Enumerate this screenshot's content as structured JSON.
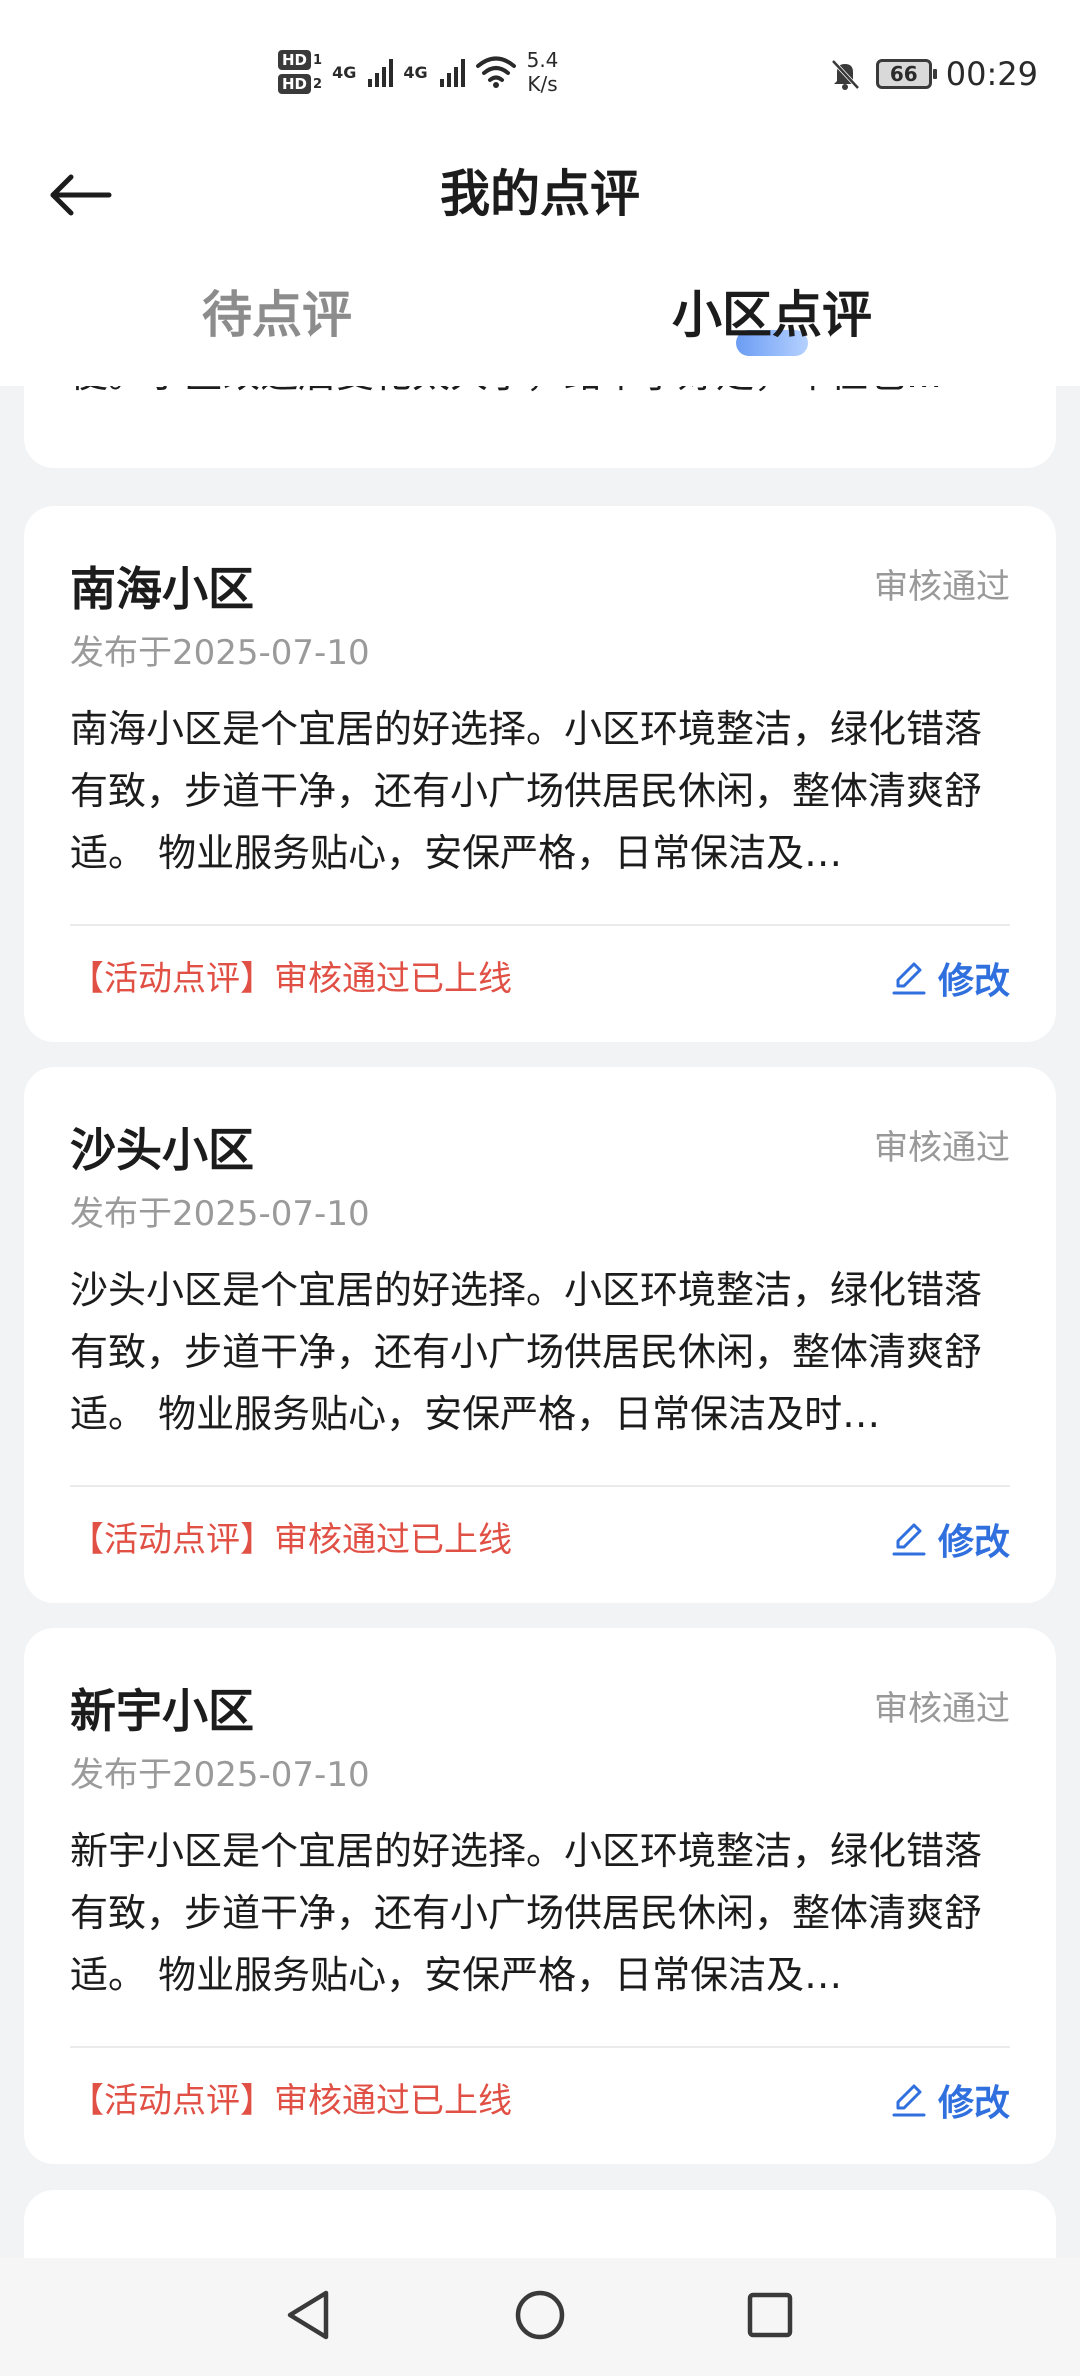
{
  "status_bar": {
    "sim1": "HD",
    "sim1_index": "1",
    "sim2": "HD",
    "sim2_index": "2",
    "network1": "4G",
    "network2": "4G",
    "speed_value": "5.4",
    "speed_unit": "K/s",
    "battery": "66",
    "time": "00:29"
  },
  "header": {
    "title": "我的点评"
  },
  "tabs": {
    "pending": "待点评",
    "community": "小区点评",
    "active": "community",
    "accent_color": "#3a7cf0"
  },
  "partial_card": {
    "text": "便。小区改造后变化太大了，路平了好走，车位也..."
  },
  "reviews": [
    {
      "name": "南海小区",
      "status": "审核通过",
      "date": "发布于2025-07-10",
      "body": "南海小区是个宜居的好选择。小区环境整洁，绿化错落有致，步道干净，还有小广场供居民休闲，整体清爽舒适。  物业服务贴心，安保严格，日常保洁及…",
      "activity": "【活动点评】审核通过已上线",
      "edit_label": "修改"
    },
    {
      "name": "沙头小区",
      "status": "审核通过",
      "date": "发布于2025-07-10",
      "body": "沙头小区是个宜居的好选择。小区环境整洁，绿化错落有致，步道干净，还有小广场供居民休闲，整体清爽舒适。 物业服务贴心，安保严格，日常保洁及时…",
      "activity": "【活动点评】审核通过已上线",
      "edit_label": "修改"
    },
    {
      "name": "新宇小区",
      "status": "审核通过",
      "date": "发布于2025-07-10",
      "body": "新宇小区是个宜居的好选择。小区环境整洁，绿化错落有致，步道干净，还有小广场供居民休闲，整体清爽舒适。  物业服务贴心，安保严格，日常保洁及…",
      "activity": "【活动点评】审核通过已上线",
      "edit_label": "修改"
    }
  ],
  "colors": {
    "activity_red": "#e05045",
    "edit_blue": "#2f6fde",
    "status_gray": "#999999"
  }
}
